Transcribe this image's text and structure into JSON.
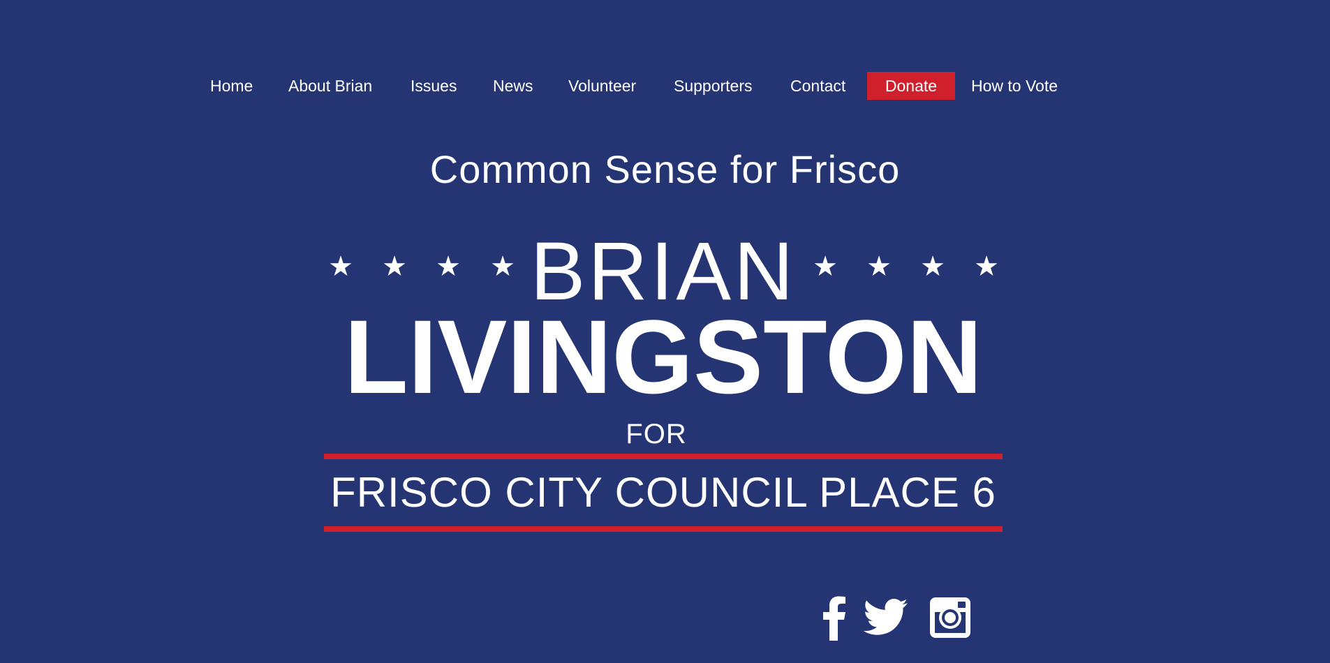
{
  "nav": {
    "items": [
      {
        "label": "Home"
      },
      {
        "label": "About Brian"
      },
      {
        "label": "Issues"
      },
      {
        "label": "News"
      },
      {
        "label": "Volunteer"
      },
      {
        "label": "Supporters"
      },
      {
        "label": "Contact"
      },
      {
        "label": "Donate"
      },
      {
        "label": "How to Vote"
      }
    ]
  },
  "hero": {
    "tagline": "Common Sense for Frisco",
    "logo": {
      "first_name": "BRIAN",
      "last_name": "LIVINGSTON",
      "for": "FOR",
      "office": "FRISCO CITY COUNCIL PLACE 6",
      "stars_each_side": 4
    }
  },
  "social": {
    "icons": [
      "facebook-icon",
      "twitter-icon",
      "instagram-icon"
    ]
  },
  "colors": {
    "background": "#253573",
    "accent": "#d0202b",
    "text": "#ffffff"
  }
}
